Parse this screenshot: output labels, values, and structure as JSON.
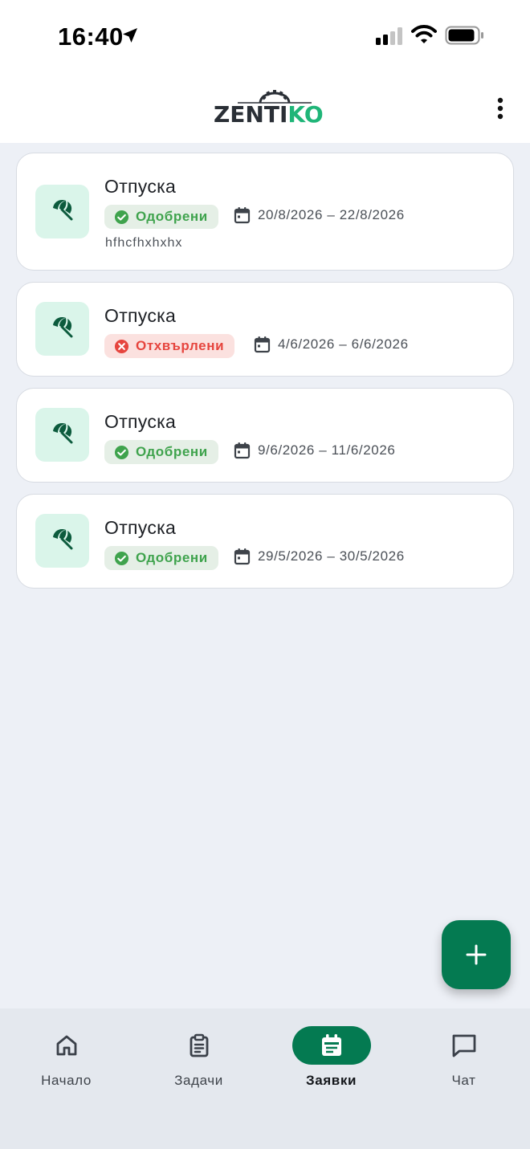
{
  "status_bar": {
    "time": "16:40",
    "icons": [
      "location-arrow-icon",
      "cellular-signal-icon",
      "wifi-icon",
      "battery-icon"
    ]
  },
  "header": {
    "logo_part1": "ZENTI",
    "logo_part2": "KO",
    "menu_icon": "more-vertical-icon"
  },
  "requests": [
    {
      "title": "Отпуска",
      "icon": "beach-umbrella-icon",
      "status": "Одобрени",
      "status_kind": "approved",
      "dates": "20/8/2026 – 22/8/2026",
      "note": "hfhcfhxhxhx"
    },
    {
      "title": "Отпуска",
      "icon": "beach-umbrella-icon",
      "status": "Отхвърлени",
      "status_kind": "rejected",
      "dates": "4/6/2026 – 6/6/2026"
    },
    {
      "title": "Отпуска",
      "icon": "beach-umbrella-icon",
      "status": "Одобрени",
      "status_kind": "approved",
      "dates": "9/6/2026 – 11/6/2026"
    },
    {
      "title": "Отпуска",
      "icon": "beach-umbrella-icon",
      "status": "Одобрени",
      "status_kind": "approved",
      "dates": "29/5/2026 – 30/5/2026"
    }
  ],
  "fab": {
    "icon": "plus-icon"
  },
  "bottom_nav": {
    "active": "Заявки",
    "items": [
      {
        "label": "Начало",
        "icon": "home-icon"
      },
      {
        "label": "Задачи",
        "icon": "clipboard-icon"
      },
      {
        "label": "Заявки",
        "icon": "calendar-event-icon"
      },
      {
        "label": "Чат",
        "icon": "chat-bubble-icon"
      }
    ]
  },
  "colors": {
    "brand": "#047a51",
    "logo_accent": "#1fb578",
    "approved": "#3fa34d",
    "rejected": "#e6453e",
    "background": "#edf0f6"
  }
}
